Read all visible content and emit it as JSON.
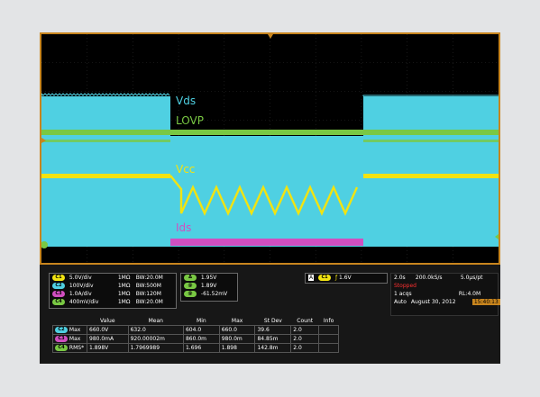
{
  "labels": {
    "vds": "Vds",
    "lovp": "LOVP",
    "vcc": "Vcc",
    "ids": "Ids"
  },
  "colors": {
    "vds": "#4fd0e2",
    "lovp": "#79c843",
    "vcc": "#f2e311",
    "ids": "#d04fc0",
    "frame": "#c8851e"
  },
  "channels": [
    {
      "id": "C1",
      "scale": "5.0V/div",
      "impedance": "1MΩ",
      "bw": "BW:20.0M",
      "color": "#f2e311"
    },
    {
      "id": "C2",
      "scale": "100V/div",
      "impedance": "1MΩ",
      "bw": "BW:500M",
      "color": "#4fd0e2"
    },
    {
      "id": "C3",
      "scale": "1.0A/div",
      "impedance": "1MΩ",
      "bw": "BW:120M",
      "color": "#d04fc0"
    },
    {
      "id": "C4",
      "scale": "400mV/div",
      "impedance": "1MΩ",
      "bw": "BW:20.0M",
      "color": "#79c843"
    }
  ],
  "cursor": {
    "delta_t": "1.95V",
    "v1": "1.89V",
    "v2": "-61.52mV"
  },
  "trigger": {
    "source": "C1",
    "level": "1.6V",
    "mode_letter": "A"
  },
  "acquisition": {
    "timebase": "2.0s",
    "sample_rate": "200.0kS/s",
    "per_pt": "5.0µs/pt",
    "status": "Stopped",
    "acqs": "1 acqs",
    "record_length": "RL:4.0M",
    "trigger_mode": "Auto",
    "date": "August 30, 2012",
    "time": "15:40:13"
  },
  "measurements": {
    "headers": [
      "Value",
      "Mean",
      "Min",
      "Max",
      "St Dev",
      "Count",
      "Info"
    ],
    "rows": [
      {
        "ch": "C2",
        "name": "Max",
        "value": "660.0V",
        "mean": "632.0",
        "min": "604.0",
        "max": "660.0",
        "stdev": "39.6",
        "count": "2.0",
        "info": ""
      },
      {
        "ch": "C3",
        "name": "Max",
        "value": "980.0mA",
        "mean": "920.00002m",
        "min": "860.0m",
        "max": "980.0m",
        "stdev": "84.85m",
        "count": "2.0",
        "info": ""
      },
      {
        "ch": "C4",
        "name": "RMS*",
        "value": "1.898V",
        "mean": "1.7969989",
        "min": "1.696",
        "max": "1.898",
        "stdev": "142.8m",
        "count": "2.0",
        "info": ""
      }
    ]
  }
}
